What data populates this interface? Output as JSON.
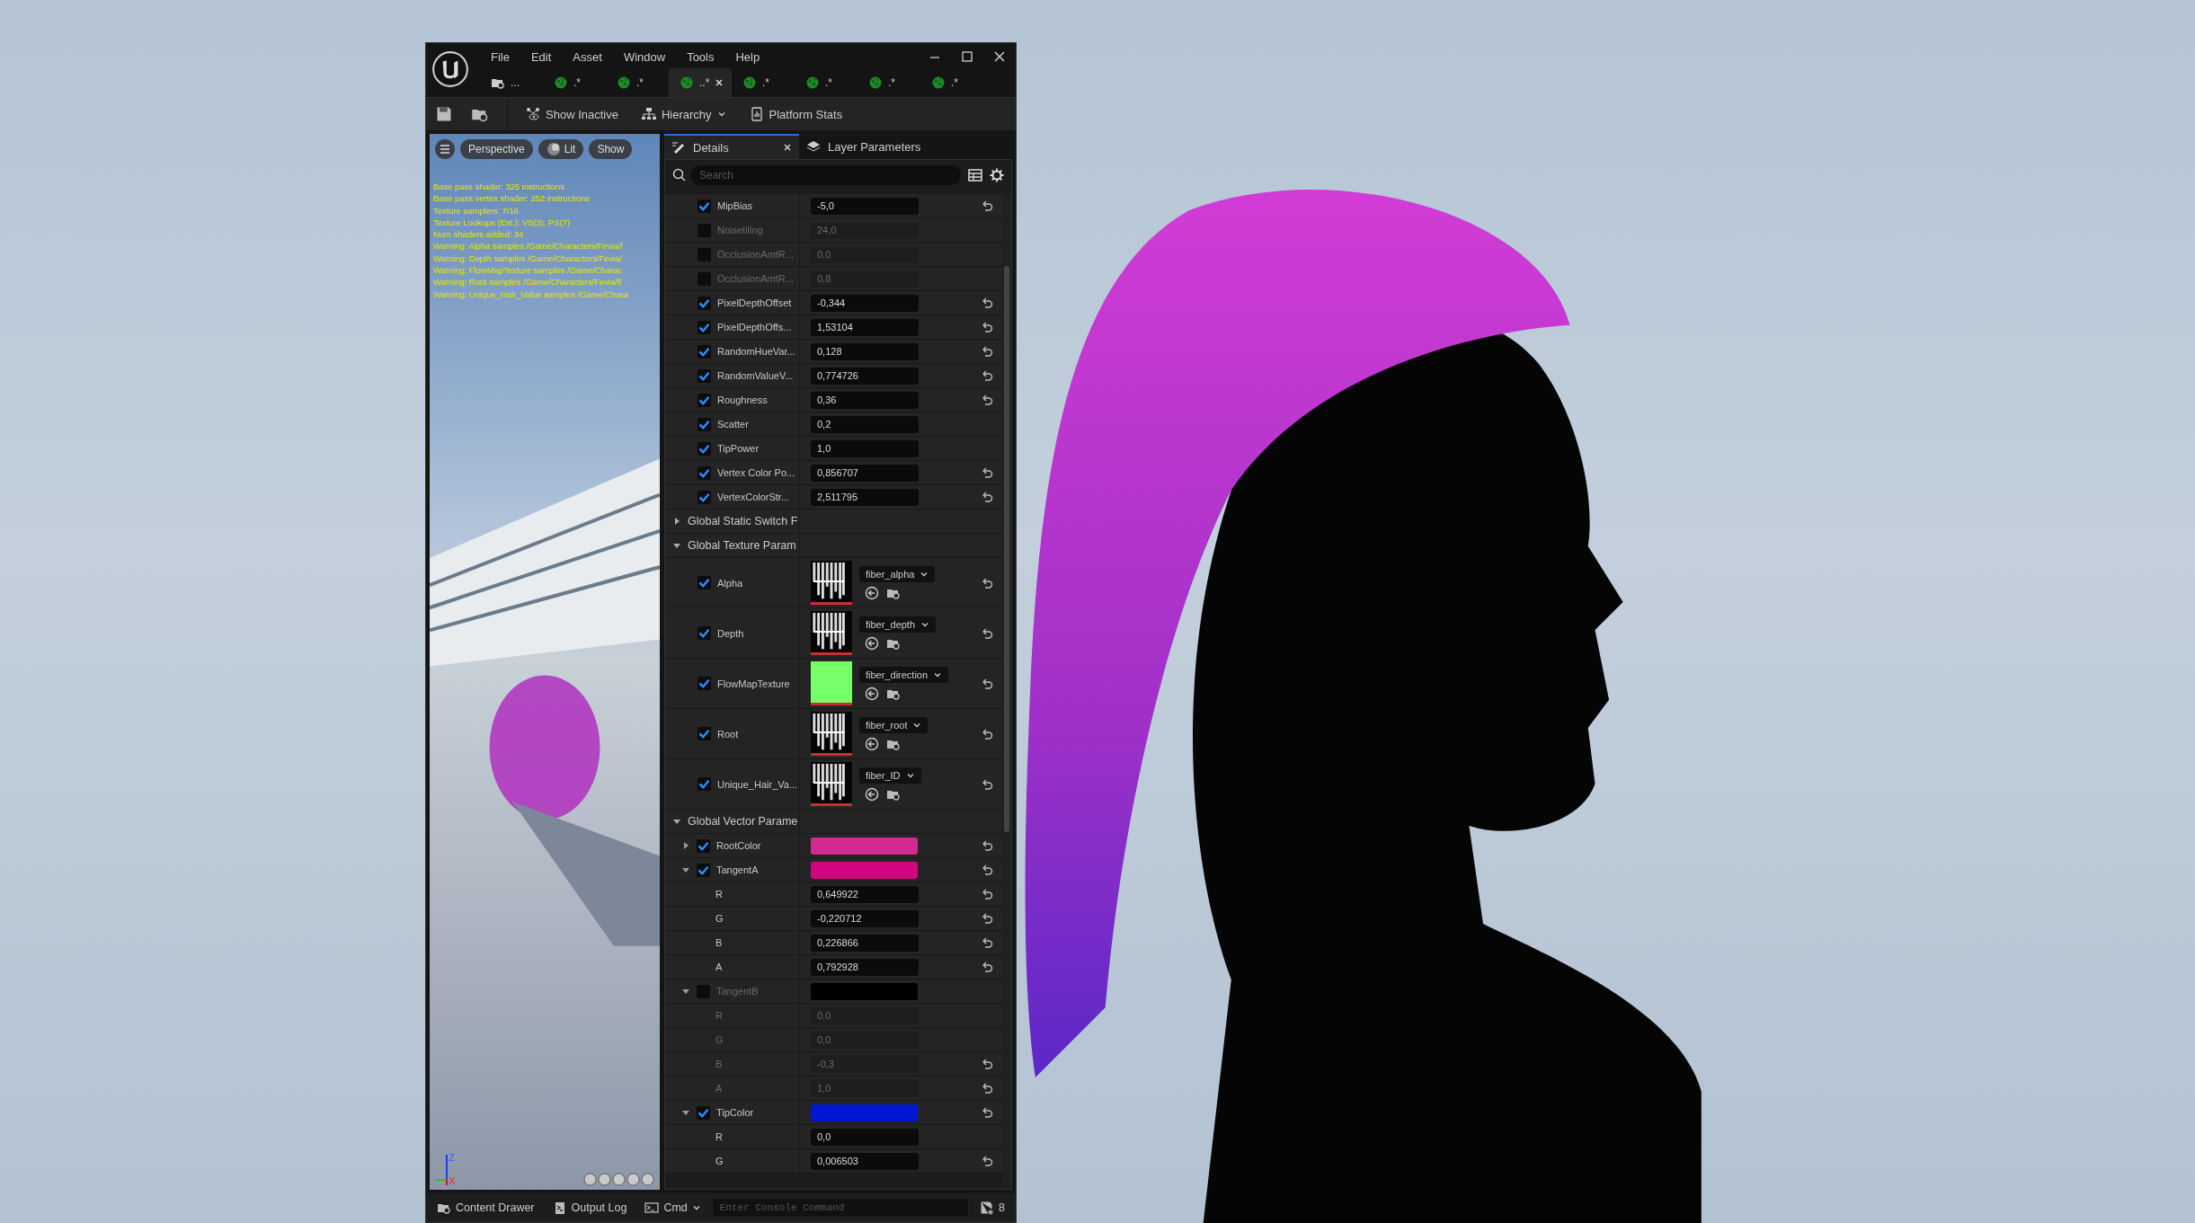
{
  "window": {
    "menu": [
      "File",
      "Edit",
      "Asset",
      "Window",
      "Tools",
      "Help"
    ],
    "document_tabs": [
      {
        "label": "...",
        "kind": "browser",
        "selected": false
      },
      {
        "label": ".*",
        "kind": "material",
        "selected": false
      },
      {
        "label": ".*",
        "kind": "material",
        "selected": false
      },
      {
        "label": "..*",
        "kind": "material",
        "selected": true
      },
      {
        "label": ".*",
        "kind": "material",
        "selected": false
      },
      {
        "label": ".*",
        "kind": "material",
        "selected": false
      },
      {
        "label": ".*",
        "kind": "material",
        "selected": false
      },
      {
        "label": ".*",
        "kind": "material",
        "selected": false
      }
    ]
  },
  "toolbar": {
    "buttons": [
      {
        "label": "Show Inactive",
        "kind": "visibility",
        "dropdown": false
      },
      {
        "label": "Hierarchy",
        "kind": "hierarchy",
        "dropdown": true
      },
      {
        "label": "Platform Stats",
        "kind": "stats",
        "dropdown": false
      }
    ]
  },
  "viewport": {
    "buttons": [
      {
        "label": "Perspective",
        "kind": "view"
      },
      {
        "label": "Lit",
        "kind": "lighting"
      },
      {
        "label": "Show",
        "kind": "show"
      }
    ],
    "stats": [
      "Base pass shader: 325 instructions",
      "Base pass vertex shader: 252 instructions",
      "Texture samplers: 7/16",
      "Texture Lookups (Est.): VS(3), PS(7)",
      "Num shaders added: 34",
      "Warning: Alpha samples /Game/Characters/Fevia/f",
      "Warning: Depth samples /Game/Characters/Fevia/",
      "Warning: FlowMapTexture samples /Game/Charac",
      "Warning: Root samples /Game/Characters/Fevia/fi",
      "Warning: Unique_Hair_Value samples /Game/Chara"
    ],
    "axes": [
      "Z",
      "X"
    ]
  },
  "details": {
    "tabs": [
      {
        "label": "Details",
        "selected": true
      },
      {
        "label": "Layer Parameters",
        "selected": false
      }
    ],
    "search": {
      "placeholder": "Search"
    },
    "rows": [
      {
        "kind": "scalar",
        "name": "MipBias",
        "checked": true,
        "value": "-5,0",
        "reset": true
      },
      {
        "kind": "scalar",
        "name": "Noisetiling",
        "checked": false,
        "value": "24,0",
        "reset": false
      },
      {
        "kind": "scalar",
        "name": "OcclusionAmtR...",
        "checked": false,
        "value": "0,0",
        "reset": false
      },
      {
        "kind": "scalar",
        "name": "OcclusionAmtR...",
        "checked": false,
        "value": "0,8",
        "reset": false
      },
      {
        "kind": "scalar",
        "name": "PixelDepthOffset",
        "checked": true,
        "value": "-0,344",
        "reset": true
      },
      {
        "kind": "scalar",
        "name": "PixelDepthOffs...",
        "checked": true,
        "value": "1,53104",
        "reset": true
      },
      {
        "kind": "scalar",
        "name": "RandomHueVar...",
        "checked": true,
        "value": "0,128",
        "reset": true
      },
      {
        "kind": "scalar",
        "name": "RandomValueV...",
        "checked": true,
        "value": "0,774726",
        "reset": true
      },
      {
        "kind": "scalar",
        "name": "Roughness",
        "checked": true,
        "value": "0,36",
        "reset": true
      },
      {
        "kind": "scalar",
        "name": "Scatter",
        "checked": true,
        "value": "0,2",
        "reset": false
      },
      {
        "kind": "scalar",
        "name": "TipPower",
        "checked": true,
        "value": "1,0",
        "reset": false
      },
      {
        "kind": "scalar",
        "name": "Vertex Color Po...",
        "checked": true,
        "value": "0,856707",
        "reset": true
      },
      {
        "kind": "scalar",
        "name": "VertexColorStr...",
        "checked": true,
        "value": "2,511795",
        "reset": true
      },
      {
        "kind": "group",
        "name": "Global Static Switch F",
        "expanded": false
      },
      {
        "kind": "group",
        "name": "Global Texture Param",
        "expanded": true
      },
      {
        "kind": "texture",
        "name": "Alpha",
        "checked": true,
        "asset": "fiber_alpha",
        "reset": true
      },
      {
        "kind": "texture",
        "name": "Depth",
        "checked": true,
        "asset": "fiber_depth",
        "reset": true
      },
      {
        "kind": "texture",
        "name": "FlowMapTexture",
        "checked": true,
        "asset": "fiber_direction",
        "reset": true,
        "color": "#77ff6a"
      },
      {
        "kind": "texture",
        "name": "Root",
        "checked": true,
        "asset": "fiber_root",
        "reset": true
      },
      {
        "kind": "texture",
        "name": "Unique_Hair_Va...",
        "checked": true,
        "asset": "fiber_ID",
        "reset": true
      },
      {
        "kind": "group",
        "name": "Global Vector Parame",
        "expanded": true
      },
      {
        "kind": "vector",
        "name": "RootColor",
        "checked": true,
        "expanded": false,
        "color": "#d22a92",
        "reset": true
      },
      {
        "kind": "vector",
        "name": "TangentA",
        "checked": true,
        "expanded": true,
        "color": "#d2057f",
        "reset": true,
        "children": [
          {
            "name": "R",
            "value": "0,649922",
            "reset": true
          },
          {
            "name": "G",
            "value": "-0,220712",
            "reset": true
          },
          {
            "name": "B",
            "value": "0,226866",
            "reset": true
          },
          {
            "name": "A",
            "value": "0,792928",
            "reset": true
          }
        ]
      },
      {
        "kind": "vector",
        "name": "TangentB",
        "checked": false,
        "expanded": true,
        "color": "#000000",
        "reset": false,
        "children": [
          {
            "name": "R",
            "value": "0,0",
            "reset": false
          },
          {
            "name": "G",
            "value": "0,0",
            "reset": false
          },
          {
            "name": "B",
            "value": "-0,3",
            "reset": true
          },
          {
            "name": "A",
            "value": "1,0",
            "reset": true
          }
        ]
      },
      {
        "kind": "vector",
        "name": "TipColor",
        "checked": true,
        "expanded": true,
        "color": "#0016d0",
        "reset": true,
        "children": [
          {
            "name": "R",
            "value": "0,0",
            "reset": false
          },
          {
            "name": "G",
            "value": "0,006503",
            "reset": true
          }
        ]
      }
    ]
  },
  "status_bar": {
    "buttons": [
      {
        "label": "Content Drawer",
        "kind": "drawer"
      },
      {
        "label": "Output Log",
        "kind": "log"
      }
    ],
    "cmd": {
      "label": "Cmd",
      "placeholder": "Enter Console Command"
    },
    "unsaved": "8"
  }
}
